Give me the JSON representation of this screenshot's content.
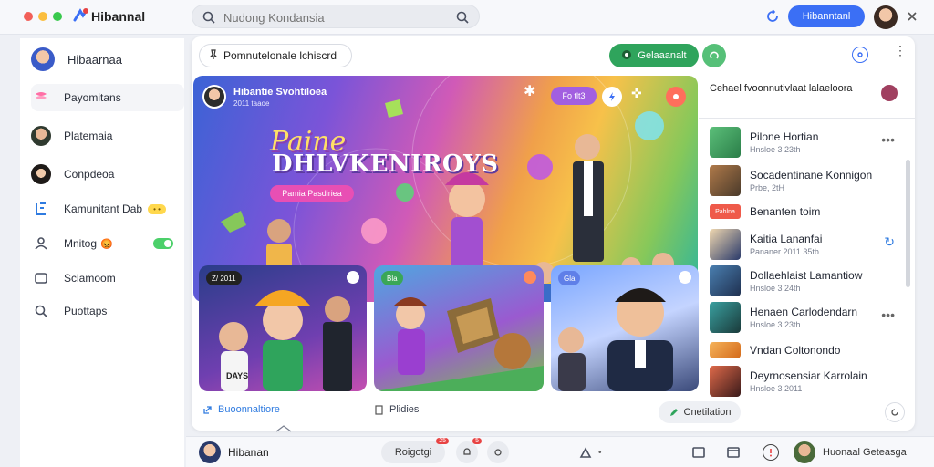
{
  "window": {
    "traffic_lights": [
      "#f25f58",
      "#fbbe3e",
      "#39c94d"
    ],
    "app_title": "Hibannal"
  },
  "search": {
    "placeholder": "Nudong Kondansia"
  },
  "header": {
    "primary_button": "Hibanntanl",
    "accent": "#3b6ff5"
  },
  "sidebar": {
    "profile_name": "Hibaarnaa",
    "items": [
      {
        "label": "Payomitans",
        "icon": "gift-icon"
      },
      {
        "label": "Platemaia",
        "icon": "avatar-icon"
      },
      {
        "label": "Conpdeoa",
        "icon": "avatar-icon"
      },
      {
        "label": "Kamunitant Dab",
        "icon": "bracket-icon",
        "badge": "• •"
      },
      {
        "label": "Mnitog",
        "icon": "people-icon",
        "emoji": "😡",
        "toggle": true
      },
      {
        "label": "Sclamoom",
        "icon": "square-icon"
      },
      {
        "label": "Puottaps",
        "icon": "search-icon"
      }
    ]
  },
  "main": {
    "subheader": "Pomnutelonale lchiscrd",
    "green_button": "Gelaaanalt",
    "hero": {
      "channel": "Hibantie Svohtiloea",
      "channel_sub": "2011 taaoe",
      "title_line1": "Paine",
      "title_line2": "DHLVKENIROYS",
      "button": "Pamia Pasdiriea",
      "chip": "Fo tlt3"
    },
    "cards": [
      {
        "chip": "Z/ 2011",
        "chip_color": "#222222",
        "shirt_text": "DAYS"
      },
      {
        "chip": "Bla",
        "chip_color": "#3aa757"
      },
      {
        "chip": "Gla",
        "chip_color": "#5f7fe8"
      }
    ],
    "tabs": [
      {
        "label": "Buoonnaltiore",
        "icon": "external-icon"
      },
      {
        "label": "Plidies",
        "icon": "doc-icon"
      }
    ],
    "bottom_right_button": "Cnetilation"
  },
  "right_panel": {
    "heading": "Cehael fvoonnutivlaat lalaeloora",
    "items": [
      {
        "title": "Pilone Hortian",
        "sub": "Hnsloe 3 23th"
      },
      {
        "title": "Socadentinane Konnigon",
        "sub": "Prbe, 2tH"
      },
      {
        "title": "Benanten toim",
        "sub": "",
        "badge": "Pahlna"
      },
      {
        "title": "Kaitia Lananfai",
        "sub": "Pananer 2011 35tb"
      },
      {
        "title": "Dollaehlaist Lamantiow",
        "sub": "Hnsloe 3 24th"
      },
      {
        "title": "Henaen Carlodendarn",
        "sub": "Hnsloe 3 23th"
      },
      {
        "title": "Vndan Coltonondo",
        "sub": ""
      },
      {
        "title": "Deyrnosensiar Karrolain",
        "sub": "Hnsloe 3 2011"
      }
    ]
  },
  "bottombar": {
    "user_name": "Hibanan",
    "pill_label": "Roigotgi",
    "pill_badge": "25",
    "notif_badge": "5",
    "right_name": "Huonaal Geteasga"
  }
}
